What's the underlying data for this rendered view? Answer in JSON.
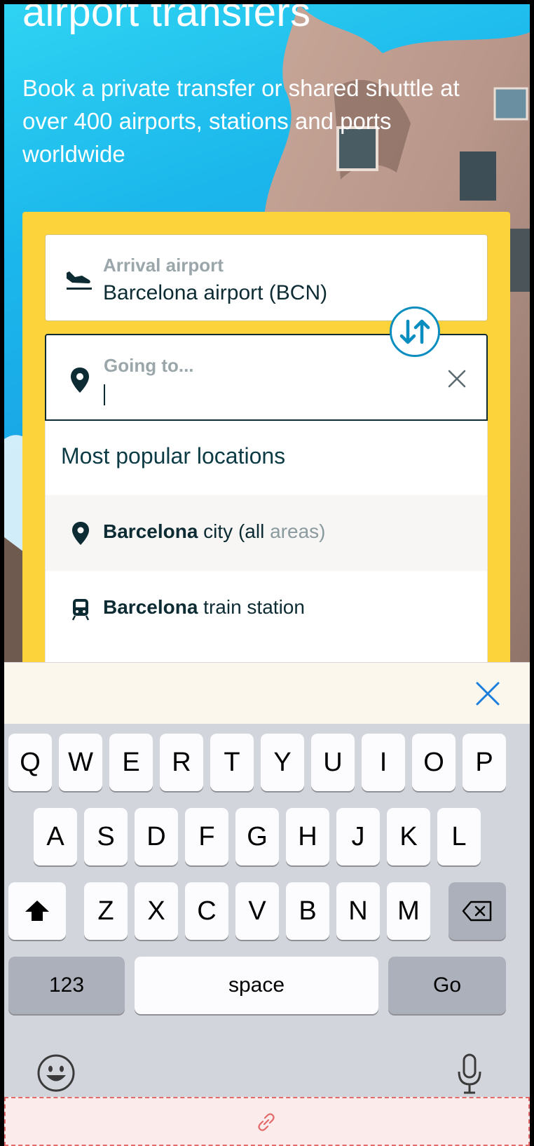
{
  "hero": {
    "title": "airport transfers",
    "subtitle": "Book a private transfer or shared shuttle at over 400 airports, stations and ports worldwide"
  },
  "booking": {
    "arrival_label": "Arrival airport",
    "arrival_value": "Barcelona airport (BCN)",
    "going_label": "Going to...",
    "going_value": ""
  },
  "dropdown": {
    "heading": "Most popular locations",
    "items": [
      {
        "bold": "Barcelona",
        "rest": " city (all ",
        "muted": "areas",
        "tail": ")",
        "icon": "map-pin-icon"
      },
      {
        "bold": "Barcelona",
        "rest": " train station",
        "muted": "",
        "tail": "",
        "icon": "train-icon"
      }
    ]
  },
  "keyboard": {
    "row1": [
      "Q",
      "W",
      "E",
      "R",
      "T",
      "Y",
      "U",
      "I",
      "O",
      "P"
    ],
    "row2": [
      "A",
      "S",
      "D",
      "F",
      "G",
      "H",
      "J",
      "K",
      "L"
    ],
    "row3": [
      "Z",
      "X",
      "C",
      "V",
      "B",
      "N",
      "M"
    ],
    "numbers_label": "123",
    "space_label": "space",
    "go_label": "Go"
  },
  "colors": {
    "card_yellow": "#fdd33b",
    "accent_blue": "#0a8ec0",
    "text_dark": "#0c2b33"
  }
}
